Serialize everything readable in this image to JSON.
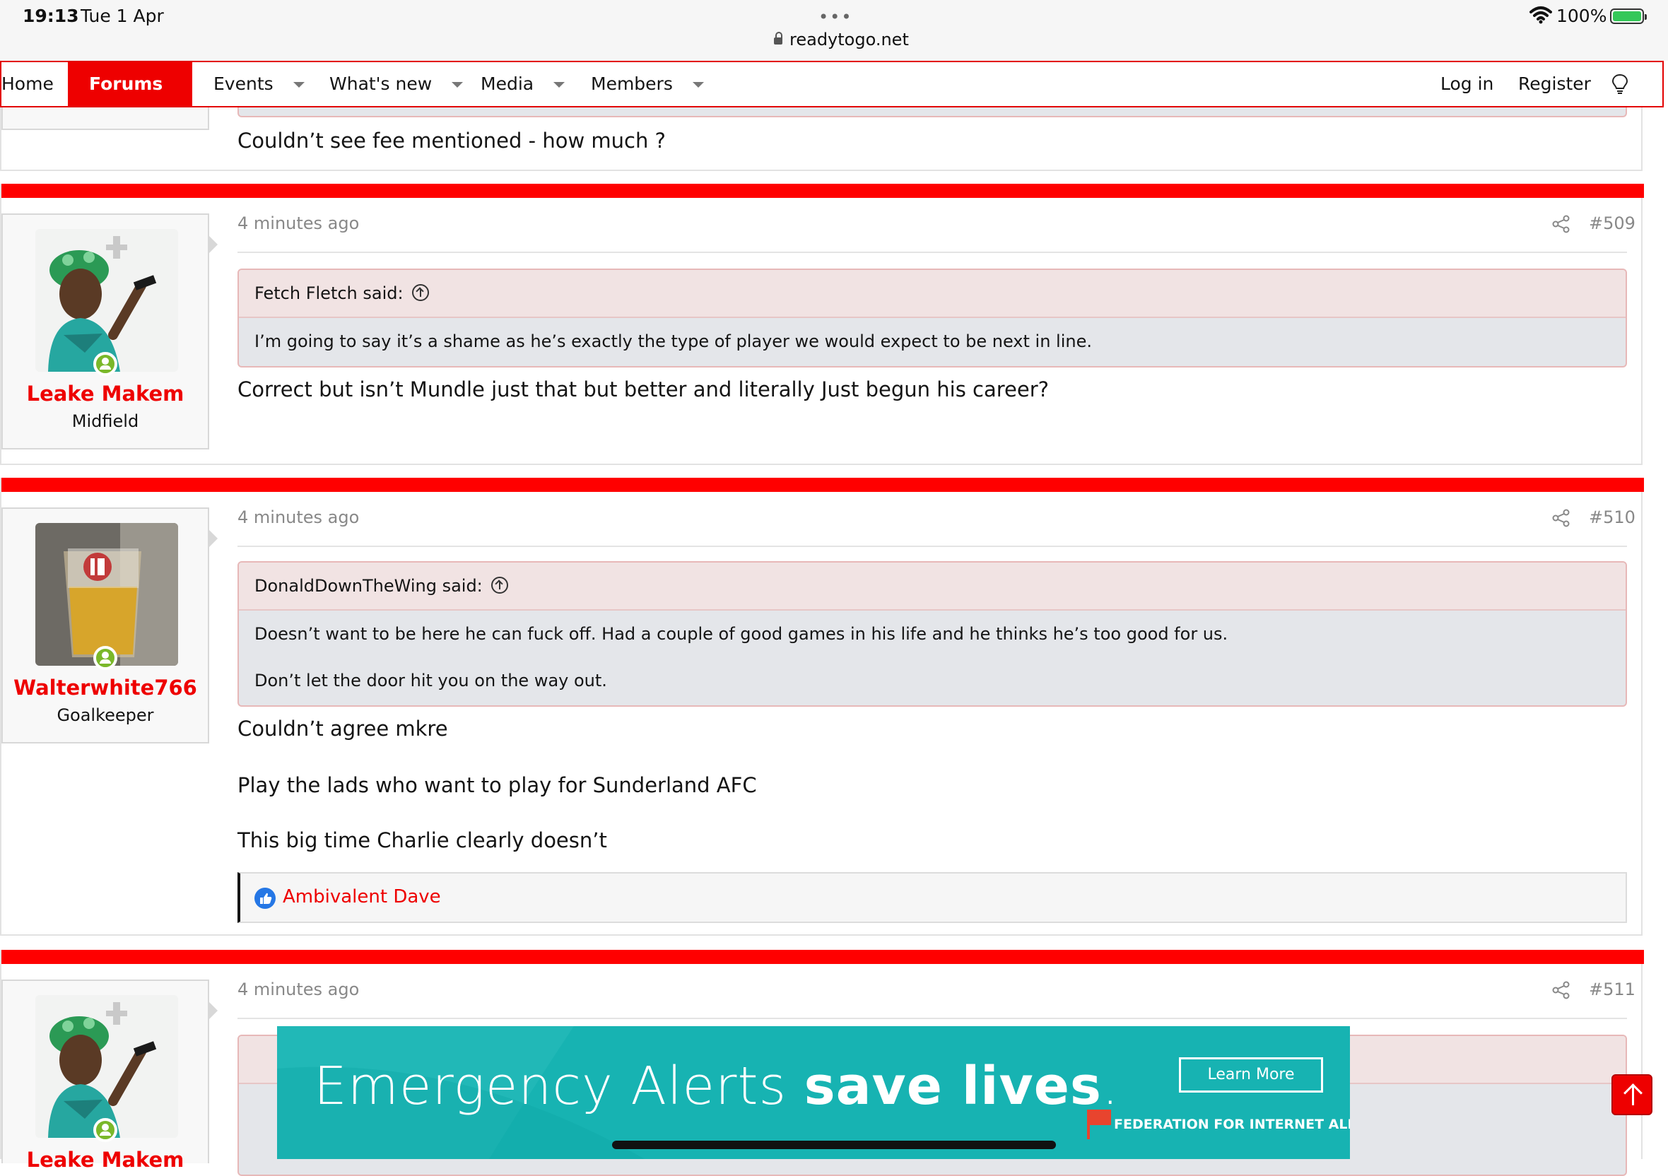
{
  "status_bar": {
    "time": "19:13",
    "date": "Tue 1 Apr",
    "dots": "•••",
    "url": "readytogo.net",
    "battery": "100%"
  },
  "nav": {
    "items": [
      {
        "label": "Home"
      },
      {
        "label": "Forums"
      },
      {
        "label": "Events"
      },
      {
        "label": "What's new"
      },
      {
        "label": "Media"
      },
      {
        "label": "Members"
      }
    ],
    "login": "Log in",
    "register": "Register"
  },
  "prev_post": {
    "message": "Couldn’t see fee mentioned - how much ?"
  },
  "posts": [
    {
      "time": "4 minutes ago",
      "number": "#509",
      "user": {
        "name": "Leake Makem",
        "title": "Midfield"
      },
      "quote": {
        "author": "Fetch Fletch said:",
        "lines": [
          "I’m going to say it’s a shame as he’s exactly the type of player we would expect to be next in line."
        ]
      },
      "message": [
        "Correct but isn’t Mundle just that but better and literally Just begun his career?"
      ]
    },
    {
      "time": "4 minutes ago",
      "number": "#510",
      "user": {
        "name": "Walterwhite766",
        "title": "Goalkeeper"
      },
      "quote": {
        "author": "DonaldDownTheWing said:",
        "lines": [
          "Doesn’t want to be here he can fuck off. Had a couple of good games in his life and he thinks he’s too good for us.",
          "Don’t let the door hit you on the way out."
        ]
      },
      "message": [
        "Couldn’t agree mkre",
        "Play the lads who want to play for Sunderland AFC",
        "This big time Charlie clearly doesn’t"
      ],
      "reaction": {
        "name": "Ambivalent Dave"
      }
    },
    {
      "time": "4 minutes ago",
      "number": "#511",
      "user": {
        "name": "Leake Makem"
      }
    }
  ],
  "ad": {
    "title_light": "Emergency Alerts ",
    "title_bold": "save lives",
    "title_end": ".",
    "button": "Learn More",
    "org": "FEDERATION FOR INTERNET ALERTS"
  },
  "colors": {
    "accent": "#ff0000",
    "username": "#ee0000",
    "ad_background": "#17b3b2"
  }
}
